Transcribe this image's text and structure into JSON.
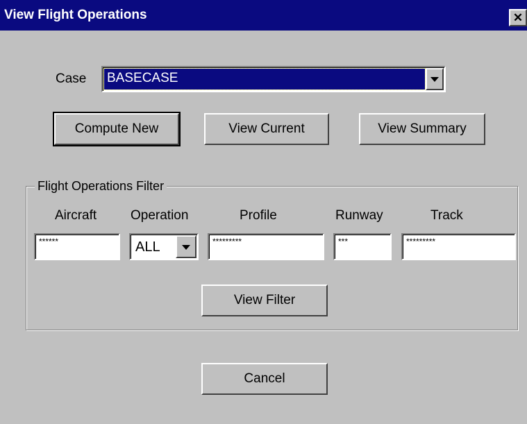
{
  "window": {
    "title": "View Flight Operations",
    "close_label": "✕"
  },
  "case": {
    "label": "Case",
    "selected": "BASECASE"
  },
  "buttons": {
    "compute_new": "Compute New",
    "view_current": "View Current",
    "view_summary": "View Summary",
    "view_filter": "View Filter",
    "cancel": "Cancel"
  },
  "filter": {
    "group_label": "Flight Operations Filter",
    "aircraft": {
      "label": "Aircraft",
      "value": "******"
    },
    "operation": {
      "label": "Operation",
      "selected": "ALL"
    },
    "profile": {
      "label": "Profile",
      "value": "*********"
    },
    "runway": {
      "label": "Runway",
      "value": "***"
    },
    "track": {
      "label": "Track",
      "value": "*********"
    }
  },
  "colors": {
    "titlebar": "#0a0a80",
    "dialog_background": "#c0c0c0",
    "selection": "#0a0a80"
  }
}
